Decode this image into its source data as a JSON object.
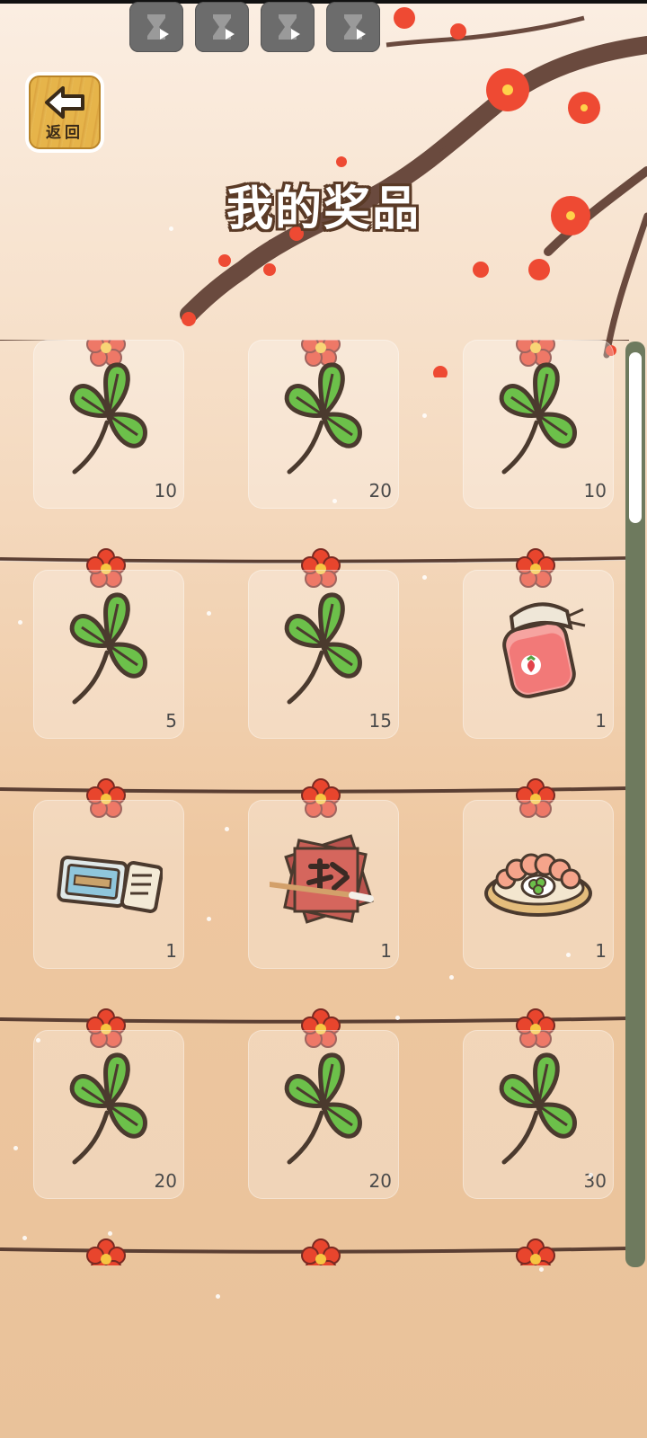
{
  "header": {
    "video_buttons": [
      "video-ad-button-1",
      "video-ad-button-2",
      "video-ad-button-3",
      "video-ad-button-4"
    ],
    "back_label": "返回",
    "title": "我的奖品"
  },
  "prizes": [
    {
      "icon": "clover-icon",
      "count": "10"
    },
    {
      "icon": "clover-icon",
      "count": "20"
    },
    {
      "icon": "clover-icon",
      "count": "10"
    },
    {
      "icon": "clover-icon",
      "count": "5"
    },
    {
      "icon": "clover-icon",
      "count": "15"
    },
    {
      "icon": "strawberry-jam-jar-icon",
      "count": "1"
    },
    {
      "icon": "ticket-icon",
      "count": "1"
    },
    {
      "icon": "calligraphy-paper-brush-icon",
      "count": "1"
    },
    {
      "icon": "shrimp-dumpling-plate-icon",
      "count": "1"
    },
    {
      "icon": "clover-icon",
      "count": "20"
    },
    {
      "icon": "clover-icon",
      "count": "20"
    },
    {
      "icon": "clover-icon",
      "count": "30"
    }
  ],
  "colors": {
    "clover": "#6cc04a",
    "outline": "#4b3a2e",
    "flower": "#e8452d",
    "scrollbar": "#6e7a5e"
  }
}
